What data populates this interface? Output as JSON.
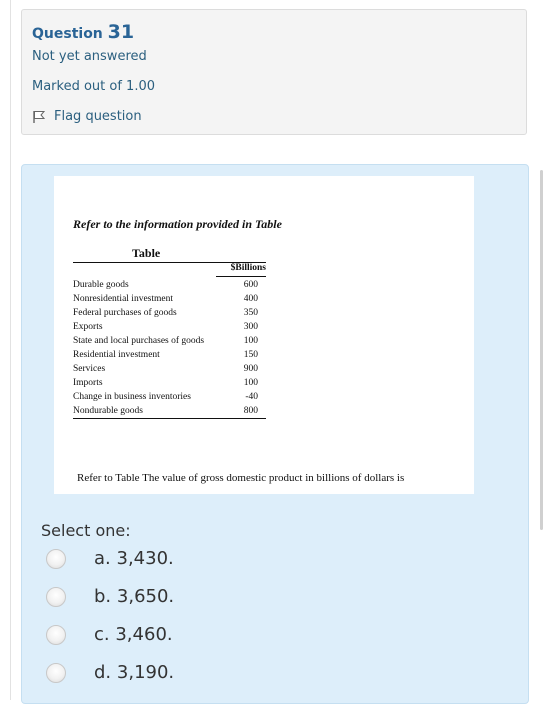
{
  "question_info": {
    "label": "Question",
    "number": "31",
    "state": "Not yet answered",
    "grade": "Marked out of 1.00",
    "flag_label": "Flag question"
  },
  "question_image": {
    "intro": "Refer to the information provided in Table",
    "table_title": "Table",
    "value_header": "$Billions",
    "rows": [
      {
        "label": "Durable goods",
        "value": "600"
      },
      {
        "label": "Nonresidential investment",
        "value": "400"
      },
      {
        "label": "Federal purchases of goods",
        "value": "350"
      },
      {
        "label": "Exports",
        "value": "300"
      },
      {
        "label": "State and local purchases of goods",
        "value": "100"
      },
      {
        "label": "Residential investment",
        "value": "150"
      },
      {
        "label": "Services",
        "value": "900"
      },
      {
        "label": "Imports",
        "value": "100"
      },
      {
        "label": "Change in business inventories",
        "value": "-40"
      },
      {
        "label": "Nondurable goods",
        "value": "800"
      }
    ],
    "prompt": "Refer to Table The value of gross domestic product in billions of dollars is"
  },
  "answer": {
    "select_label": "Select one:",
    "options": [
      {
        "letter": "a.",
        "text": "3,430."
      },
      {
        "letter": "b.",
        "text": "3,650."
      },
      {
        "letter": "c.",
        "text": "3,460."
      },
      {
        "letter": "d.",
        "text": "3,190."
      }
    ]
  },
  "colors": {
    "info_bg": "#f4f4f4",
    "formulation_bg": "#ddeefa",
    "link_blue": "#2b5f7f"
  }
}
